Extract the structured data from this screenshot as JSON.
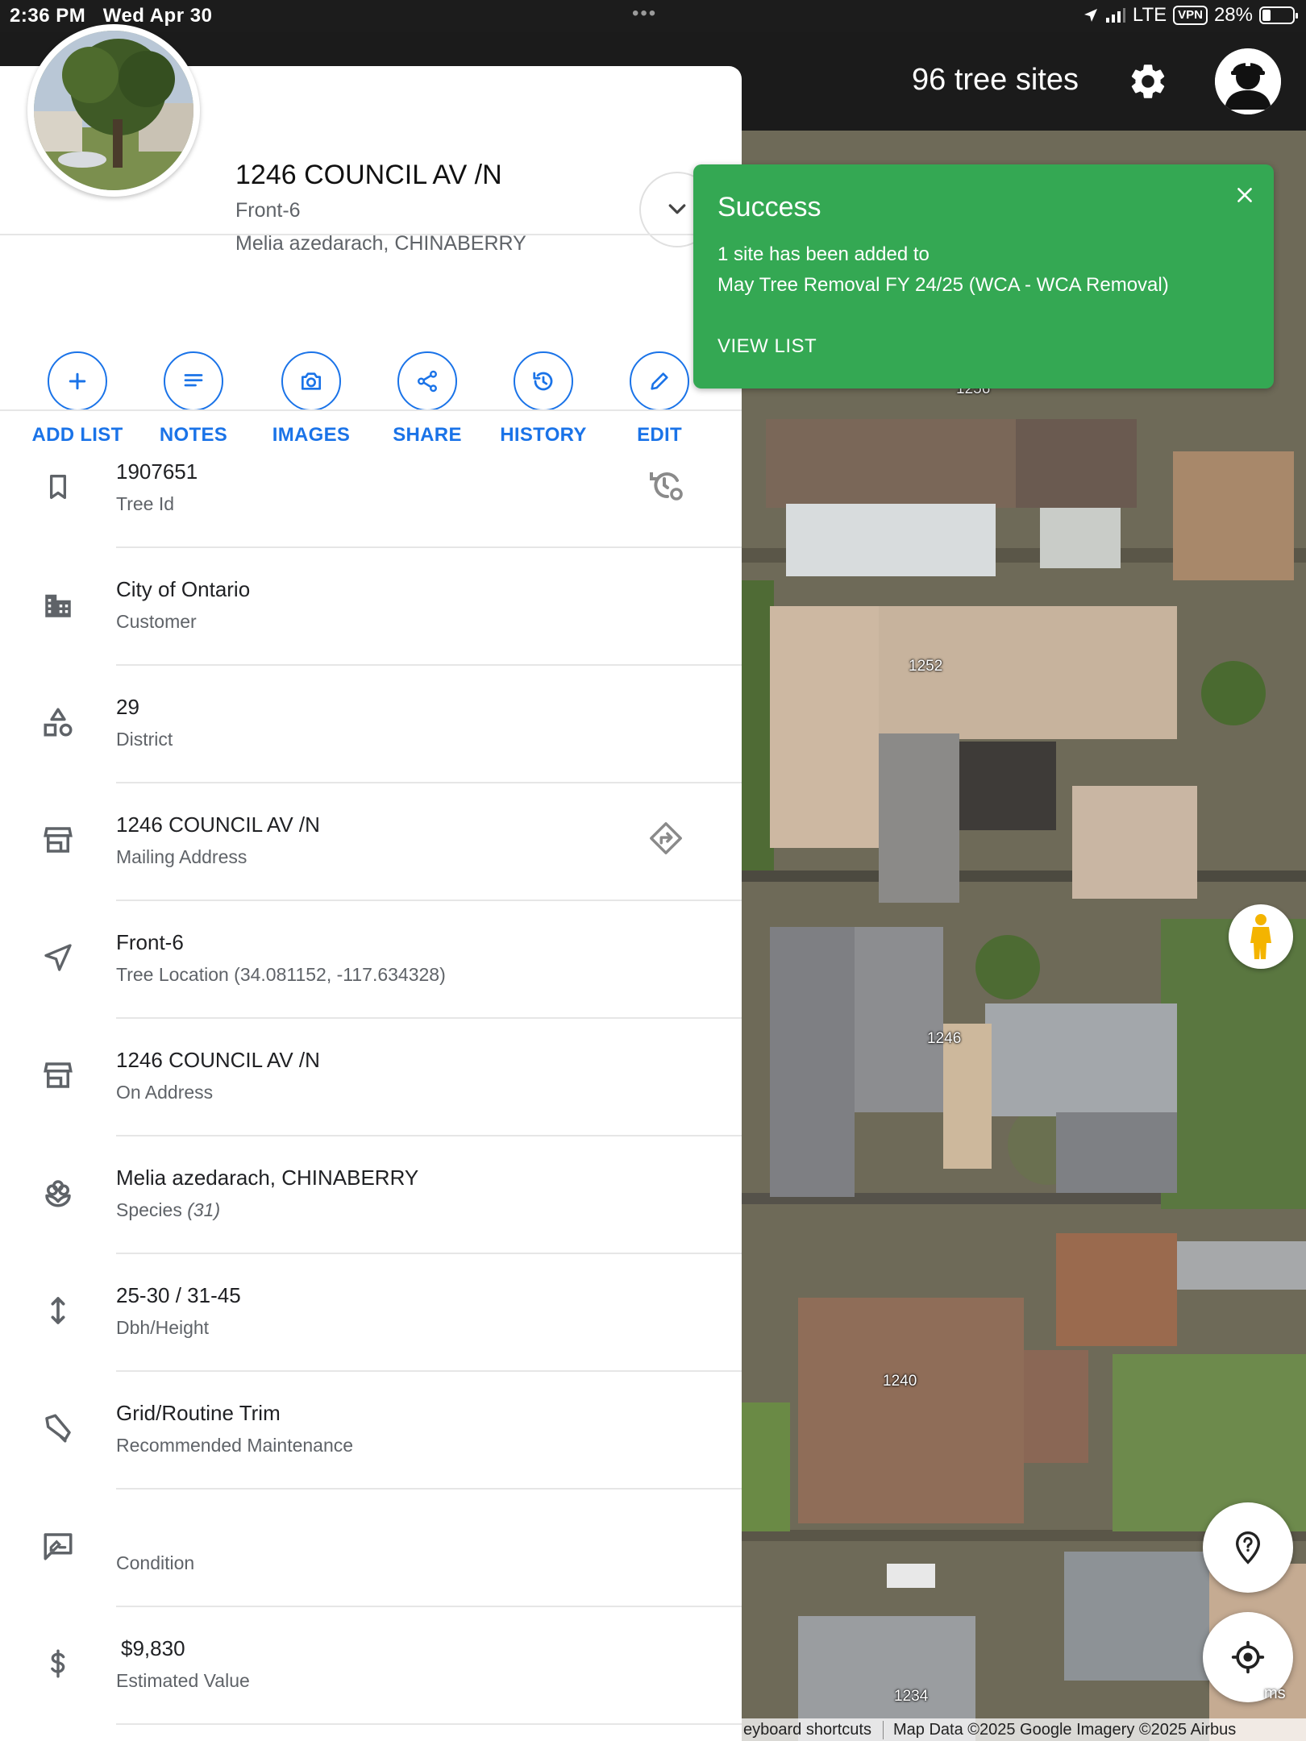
{
  "status_bar": {
    "time": "2:36 PM",
    "date": "Wed Apr 30",
    "dots": "•••",
    "network": "LTE",
    "vpn": "VPN",
    "battery": "28%",
    "battery_level": 0.28
  },
  "header": {
    "site_count": "96 tree sites"
  },
  "panel": {
    "title": "1246 COUNCIL AV /N",
    "subtitle1": "Front-6",
    "subtitle2": "Melia azedarach, CHINABERRY",
    "actions": [
      {
        "label": "ADD LIST",
        "icon": "plus-icon"
      },
      {
        "label": "NOTES",
        "icon": "notes-icon"
      },
      {
        "label": "IMAGES",
        "icon": "camera-icon"
      },
      {
        "label": "SHARE",
        "icon": "share-icon"
      },
      {
        "label": "HISTORY",
        "icon": "history-icon"
      },
      {
        "label": "EDIT",
        "icon": "pencil-icon"
      }
    ],
    "rows": [
      {
        "value": "1907651",
        "label": "Tree Id",
        "icon": "bookmark-icon"
      },
      {
        "value": "City of Ontario",
        "label": "Customer",
        "icon": "building-icon"
      },
      {
        "value": "29",
        "label": "District",
        "icon": "shapes-icon"
      },
      {
        "value": "1246 COUNCIL AV /N",
        "label": "Mailing Address",
        "icon": "storefront-icon"
      },
      {
        "value": "Front-6",
        "label": "Tree Location (34.081152, -117.634328)",
        "icon": "navigation-arrow-icon"
      },
      {
        "value": "1246 COUNCIL AV /N",
        "label": "On Address",
        "icon": "storefront-icon"
      },
      {
        "value": "Melia azedarach, CHINABERRY",
        "label": "Species",
        "label_extra": "(31)",
        "icon": "flower-icon"
      },
      {
        "value": "25-30 / 31-45",
        "label": "Dbh/Height",
        "icon": "vertical-arrows-icon"
      },
      {
        "value": "Grid/Routine Trim",
        "label": "Recommended Maintenance",
        "icon": "trim-icon"
      },
      {
        "value": "",
        "label": "Condition",
        "icon": "rate-review-icon"
      },
      {
        "value": "$9,830",
        "label": "Estimated Value",
        "icon": "dollar-icon"
      }
    ]
  },
  "toast": {
    "title": "Success",
    "line1": "1 site has been added to",
    "line2": "May Tree Removal FY 24/25 (WCA - WCA Removal)",
    "link": "VIEW LIST"
  },
  "map": {
    "house_labels": [
      "1256",
      "1252",
      "1246",
      "1240",
      "1234"
    ],
    "attribution_keys": "eyboard shortcuts",
    "attribution_data": "Map Data ©2025 Google Imagery ©2025 Airbus",
    "terms_fragment": "ms"
  },
  "colors": {
    "accent": "#1a73e8",
    "success": "#34a853",
    "header": "#1b1b1b"
  }
}
